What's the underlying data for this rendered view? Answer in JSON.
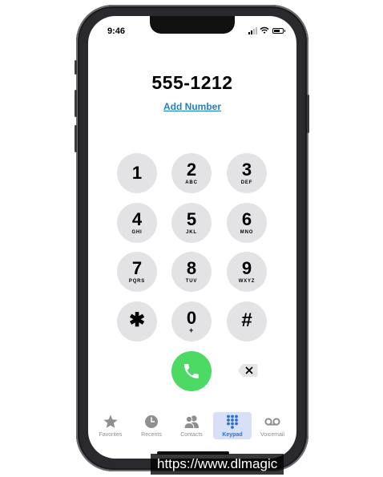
{
  "status_bar": {
    "time": "9:46",
    "battery_level": 0.7
  },
  "dialer": {
    "number": "555-1212",
    "add_number_label": "Add Number",
    "keys": [
      {
        "digit": "1",
        "letters": ""
      },
      {
        "digit": "2",
        "letters": "ABC"
      },
      {
        "digit": "3",
        "letters": "DEF"
      },
      {
        "digit": "4",
        "letters": "GHI"
      },
      {
        "digit": "5",
        "letters": "JKL"
      },
      {
        "digit": "6",
        "letters": "MNO"
      },
      {
        "digit": "7",
        "letters": "PQRS"
      },
      {
        "digit": "8",
        "letters": "TUV"
      },
      {
        "digit": "9",
        "letters": "WXYZ"
      },
      {
        "digit": "✱",
        "letters": ""
      },
      {
        "digit": "0",
        "letters": "+"
      },
      {
        "digit": "#",
        "letters": ""
      }
    ],
    "call_icon": "phone-icon",
    "delete_icon": "delete-backspace-icon"
  },
  "tabs": [
    {
      "label": "Favorites",
      "icon": "star-icon",
      "active": false
    },
    {
      "label": "Recents",
      "icon": "clock-icon",
      "active": false
    },
    {
      "label": "Contacts",
      "icon": "contacts-icon",
      "active": false
    },
    {
      "label": "Keypad",
      "icon": "keypad-icon",
      "active": true
    },
    {
      "label": "Voicemail",
      "icon": "voicemail-icon",
      "active": false
    }
  ],
  "colors": {
    "accent": "#1f7fd1",
    "call_green": "#4cd964",
    "key_gray": "#e3e3e5",
    "active_tab": "#2a6fd6"
  },
  "watermark": {
    "text": "https://www.dlmagic"
  }
}
